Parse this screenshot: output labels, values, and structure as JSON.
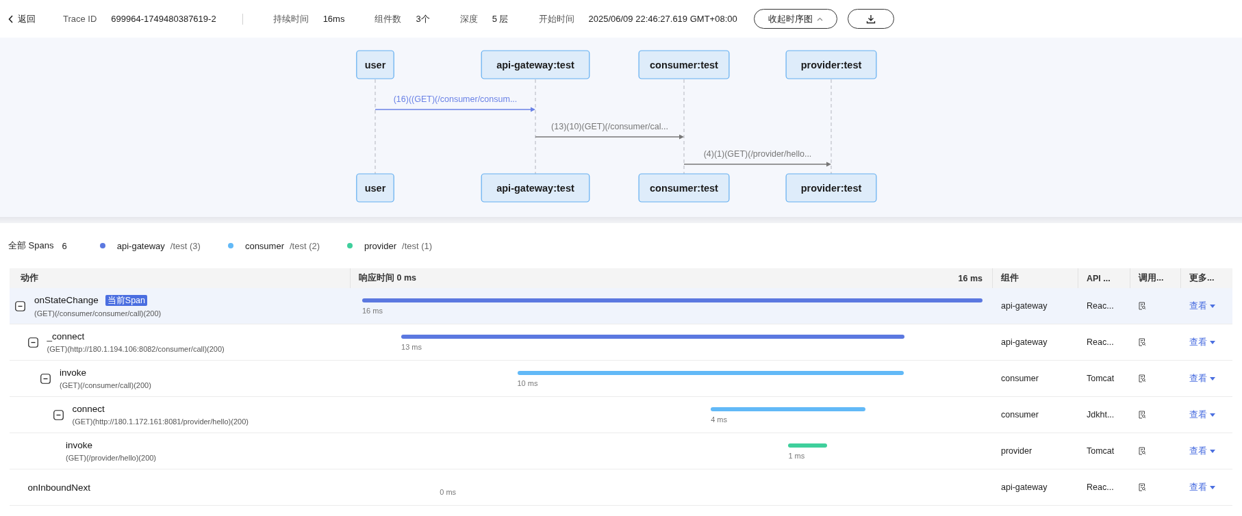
{
  "header": {
    "back": "返回",
    "fields": [
      {
        "label": "Trace ID",
        "value": "699964-1749480387619-2"
      },
      {
        "label": "持续时间",
        "value": "16ms"
      },
      {
        "label": "组件数",
        "value": "3个"
      },
      {
        "label": "深度",
        "value": "5 层"
      },
      {
        "label": "开始时间",
        "value": "2025/06/09 22:46:27.619 GMT+08:00"
      }
    ],
    "collapse_button": "收起时序图"
  },
  "sequence": {
    "participants_top": [
      "user",
      "api-gateway:test",
      "consumer:test",
      "provider:test"
    ],
    "participants_bottom": [
      "user",
      "api-gateway:test",
      "consumer:test",
      "provider:test"
    ],
    "messages": [
      {
        "label": "(16)((GET)(/consumer/consum...",
        "selected": true
      },
      {
        "label": "(13)(10)(GET)(/consumer/cal...",
        "selected": false
      },
      {
        "label": "(4)(1)(GET)(/provider/hello...",
        "selected": false
      }
    ]
  },
  "legend": {
    "label": "全部 Spans",
    "count": "6",
    "items": [
      {
        "name": "api-gateway",
        "suffix": "/test (3)",
        "color": "#5b78e0"
      },
      {
        "name": "consumer",
        "suffix": "/test (2)",
        "color": "#62b9f7"
      },
      {
        "name": "provider",
        "suffix": "/test (1)",
        "color": "#3fcf9c"
      }
    ]
  },
  "table": {
    "columns": [
      "动作",
      "响应时间 0 ms",
      "16 ms",
      "组件",
      "API ...",
      "调用...",
      "更多..."
    ],
    "spans": [
      {
        "name": "onStateChange",
        "badge": "当前Span",
        "detail": "(GET)(/consumer/consumer/call)(200)",
        "duration": "16 ms",
        "color": "#5b78e0",
        "component": "api-gateway",
        "api": "Reac...",
        "action": "查看",
        "selected": true,
        "expanded": true,
        "children": [
          {
            "name": "_connect",
            "detail": "(GET)(http://180.1.194.106:8082/consumer/call)(200)",
            "duration": "13 ms",
            "color": "#5b78e0",
            "component": "api-gateway",
            "api": "Reac...",
            "action": "查看",
            "selected": false,
            "expanded": true,
            "children": [
              {
                "name": "invoke",
                "detail": "(GET)(/consumer/call)(200)",
                "duration": "10 ms",
                "color": "#62b9f7",
                "component": "consumer",
                "api": "Tomcat",
                "action": "查看",
                "selected": false,
                "expanded": true,
                "children": [
                  {
                    "name": "connect",
                    "detail": "(GET)(http://180.1.172.161:8081/provider/hello)(200)",
                    "duration": "4 ms",
                    "color": "#62b9f7",
                    "component": "consumer",
                    "api": "Jdkht...",
                    "action": "查看",
                    "selected": false,
                    "expanded": true,
                    "children": [
                      {
                        "name": "invoke",
                        "detail": "(GET)(/provider/hello)(200)",
                        "duration": "1 ms",
                        "color": "#3fcf9c",
                        "component": "provider",
                        "api": "Tomcat",
                        "action": "查看",
                        "selected": false
                      }
                    ]
                  }
                ]
              }
            ]
          },
          {
            "name": "onInboundNext",
            "duration": "0 ms",
            "component": "api-gateway",
            "api": "Reac...",
            "action": "查看",
            "selected": false
          }
        ]
      }
    ]
  }
}
